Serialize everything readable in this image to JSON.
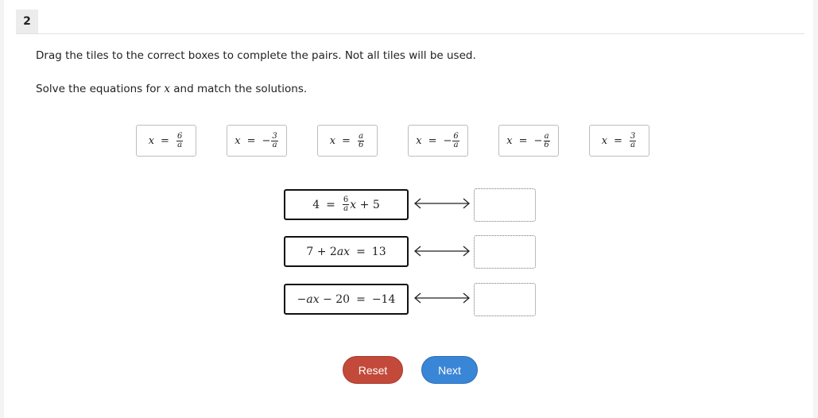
{
  "question": {
    "number": "2",
    "instruction": "Drag the tiles to the correct boxes to complete the pairs. Not all tiles will be used.",
    "prompt_before": "Solve the equations for ",
    "prompt_var": "x",
    "prompt_after": " and match the solutions."
  },
  "tiles": [
    {
      "lhs": "x",
      "sign": "",
      "num": "6",
      "den": "a"
    },
    {
      "lhs": "x",
      "sign": "−",
      "num": "3",
      "den": "a"
    },
    {
      "lhs": "x",
      "sign": "",
      "num": "a",
      "den": "6"
    },
    {
      "lhs": "x",
      "sign": "−",
      "num": "6",
      "den": "a"
    },
    {
      "lhs": "x",
      "sign": "−",
      "num": "a",
      "den": "6"
    },
    {
      "lhs": "x",
      "sign": "",
      "num": "3",
      "den": "a"
    }
  ],
  "equations": [
    {
      "p1": "4",
      "eq": "=",
      "num": "6",
      "den": "a",
      "var": "x",
      "p2": "+ 5"
    },
    {
      "p1": "7 + 2",
      "var1": "ax",
      "eq": "=",
      "p2": "13"
    },
    {
      "p1": "−",
      "var1": "ax",
      "p2": "− 20",
      "eq": "=",
      "p3": "−14"
    }
  ],
  "buttons": {
    "reset": "Reset",
    "next": "Next"
  },
  "colors": {
    "reset": "#c34a3a",
    "next": "#3a86d6"
  }
}
